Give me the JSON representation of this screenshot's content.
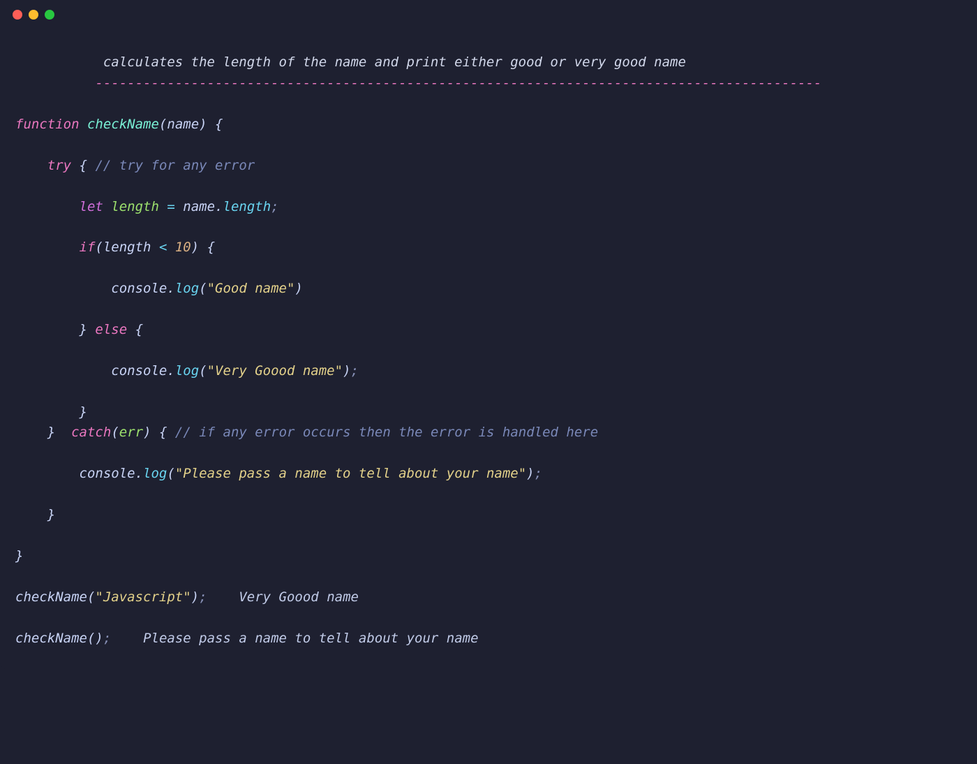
{
  "colors": {
    "background": "#1e2030",
    "dot_red": "#ff5f57",
    "dot_yellow": "#febc2e",
    "dot_green": "#28c840"
  },
  "code": {
    "header_comment": "calculates the length of the name and print either good or very good name",
    "divider": "-------------------------------------------------------------------------------------------",
    "kw_function": "function",
    "fn_name": "checkName",
    "param_name": "name",
    "kw_try": "try",
    "comment_try": "// try for any error",
    "kw_let": "let",
    "var_length": "length",
    "ident_name": "name",
    "prop_length": "length",
    "kw_if": "if",
    "op_lt": "<",
    "num_10": "10",
    "ident_console": "console",
    "method_log": "log",
    "str_good": "\"Good name\"",
    "kw_else": "else",
    "str_verygood": "\"Very Goood name\"",
    "kw_catch": "catch",
    "param_err": "err",
    "comment_catch": "// if any error occurs then the error is handled here",
    "str_please": "\"Please pass a name to tell about your name\"",
    "call1_arg": "\"Javascript\"",
    "output1": "Very Goood name",
    "output2": "Please pass a name to tell about your name"
  }
}
